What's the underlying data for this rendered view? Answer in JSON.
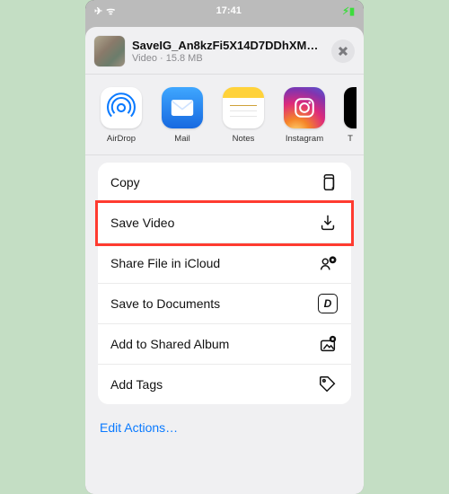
{
  "status": {
    "airplane_glyph": "✈︎",
    "wifi_glyph": "ᯤ",
    "time": "17:41",
    "battery_glyph": "▮▮"
  },
  "file": {
    "title": "SaveIG_An8kzFi5X14D7DDhXM…",
    "kind": "Video",
    "sep": " · ",
    "size": "15.8 MB"
  },
  "apps": [
    {
      "label": "AirDrop"
    },
    {
      "label": "Mail"
    },
    {
      "label": "Notes"
    },
    {
      "label": "Instagram"
    },
    {
      "label": "T"
    }
  ],
  "actions": [
    {
      "label": "Copy",
      "highlight": false
    },
    {
      "label": "Save Video",
      "highlight": true
    },
    {
      "label": "Share File in iCloud",
      "highlight": false
    },
    {
      "label": "Save to Documents",
      "highlight": false
    },
    {
      "label": "Add to Shared Album",
      "highlight": false
    },
    {
      "label": "Add Tags",
      "highlight": false
    }
  ],
  "edit_actions_label": "Edit Actions…",
  "colors": {
    "highlight": "#ff3b30",
    "link": "#0a7aff",
    "sheet_bg": "#f0f0f2",
    "page_bg": "#c4dec4"
  }
}
